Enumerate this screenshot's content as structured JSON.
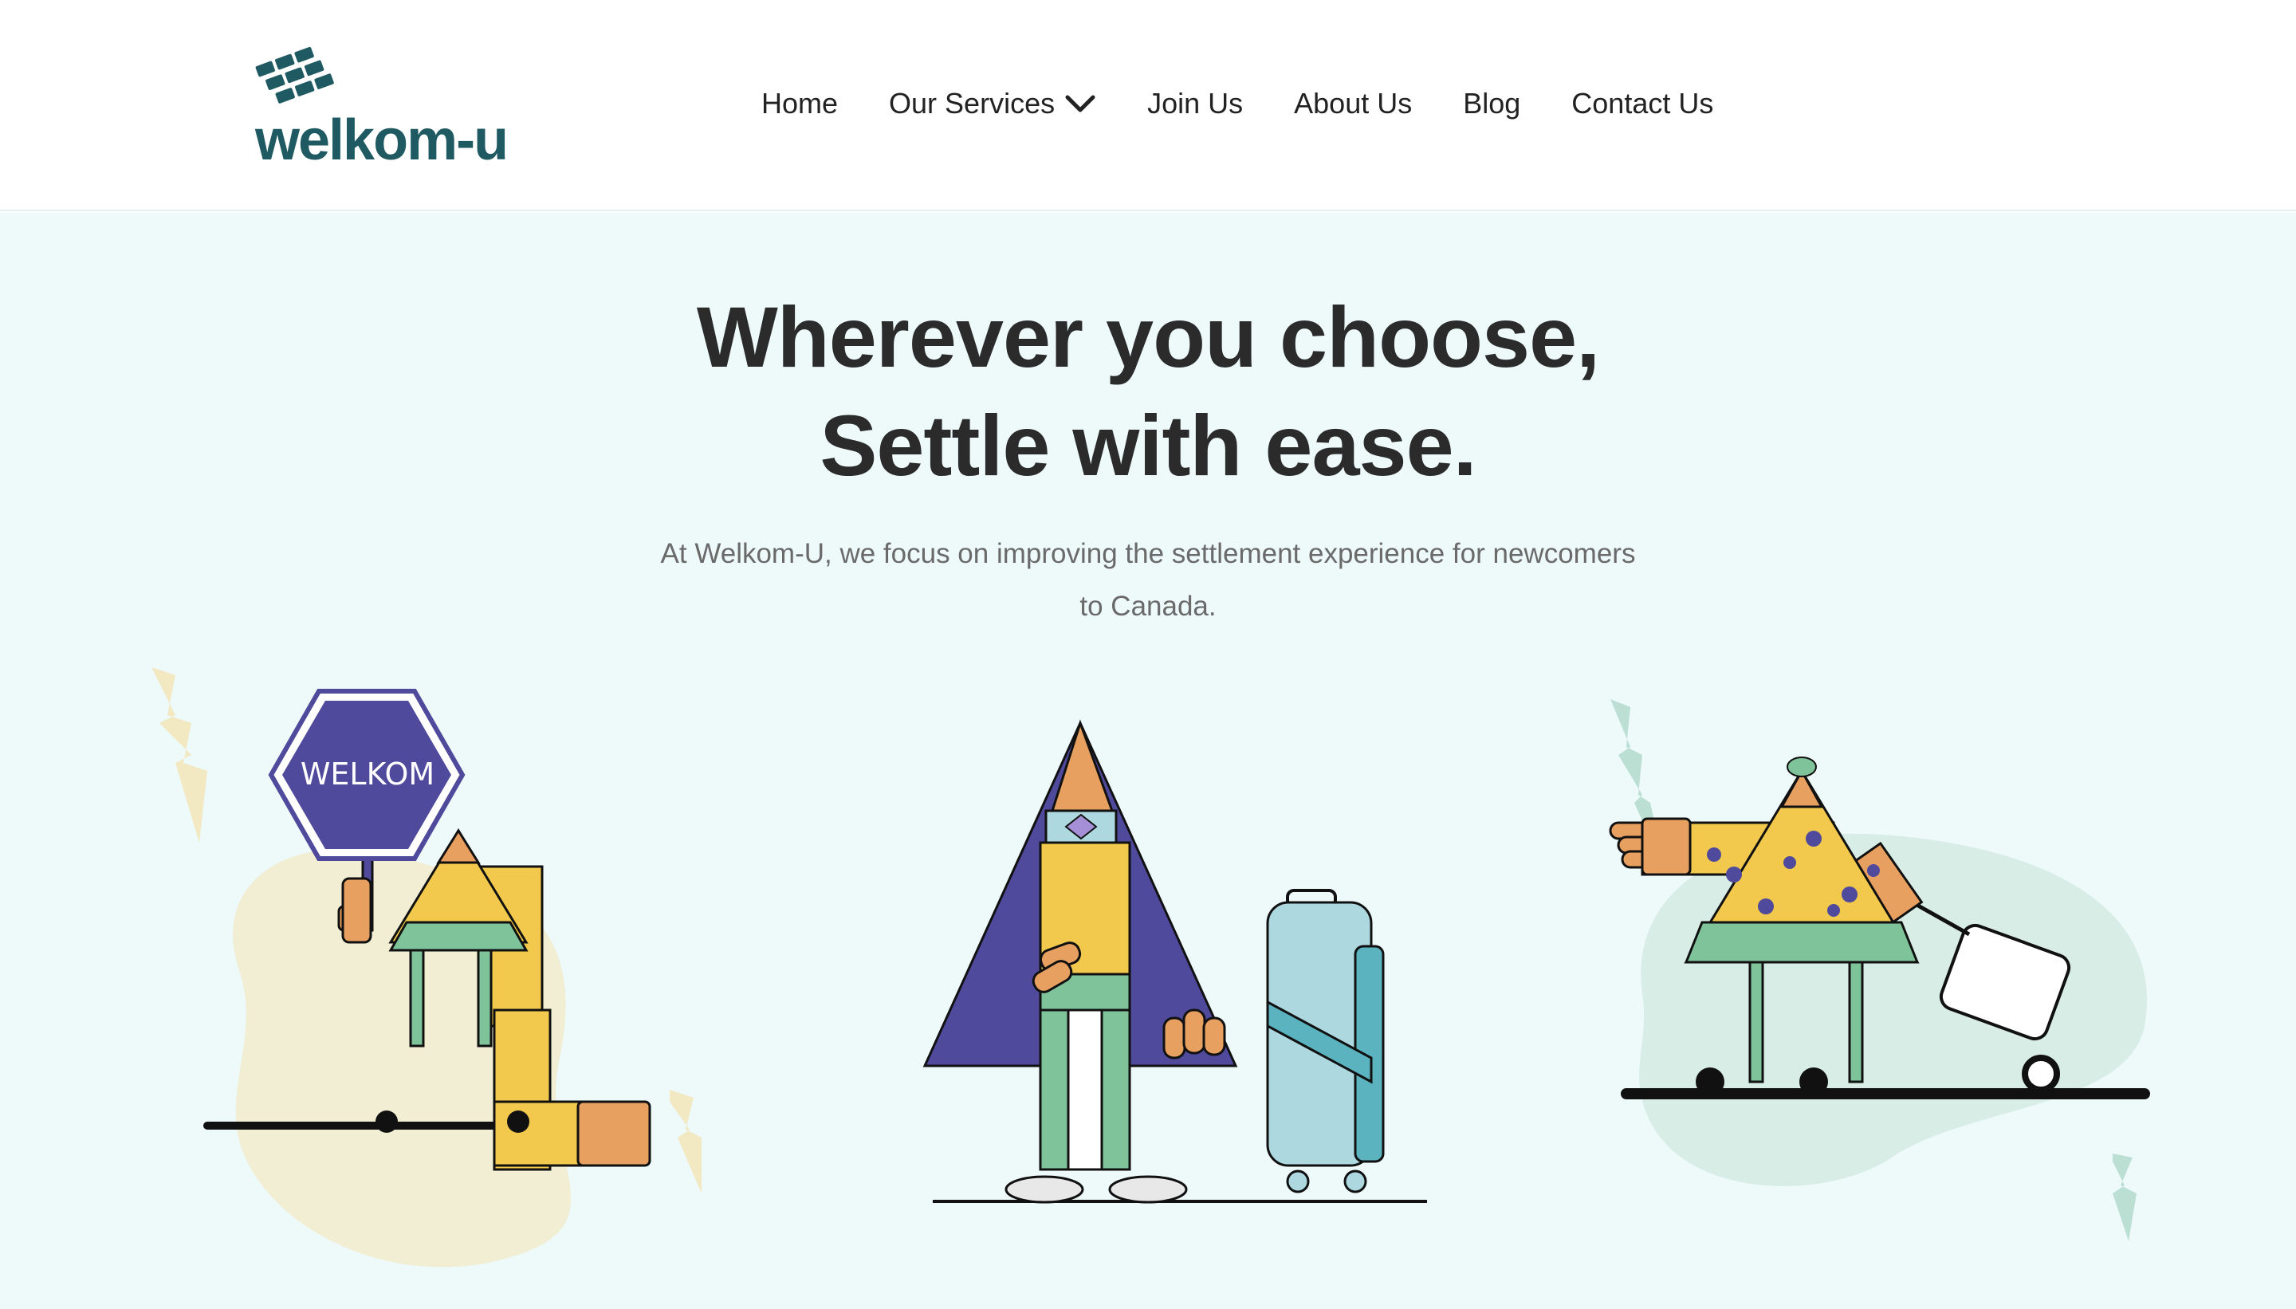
{
  "brand": {
    "name": "welkom-u",
    "color": "#1f5a63"
  },
  "nav": {
    "items": [
      {
        "label": "Home"
      },
      {
        "label": "Our Services",
        "has_dropdown": true
      },
      {
        "label": "Join Us"
      },
      {
        "label": "About Us"
      },
      {
        "label": "Blog"
      },
      {
        "label": "Contact Us"
      }
    ]
  },
  "hero": {
    "headline_line1": "Wherever you choose,",
    "headline_line2": "Settle with ease.",
    "subtitle_line1": "At Welkom-U, we focus on improving the settlement experience for newcomers",
    "subtitle_line2": "to Canada.",
    "background": "#eef9f9"
  },
  "illustrations": {
    "left_sign_text": "WELKOM",
    "left": "character-holding-welkom-sign",
    "center": "character-with-coat-and-suitcase",
    "right": "character-pulling-luggage-cart"
  },
  "colors": {
    "purple": "#4f4a9c",
    "yellow": "#f2c94c",
    "orange": "#e8a060",
    "green": "#7fc39a",
    "suitcase": "#aed8e0"
  }
}
